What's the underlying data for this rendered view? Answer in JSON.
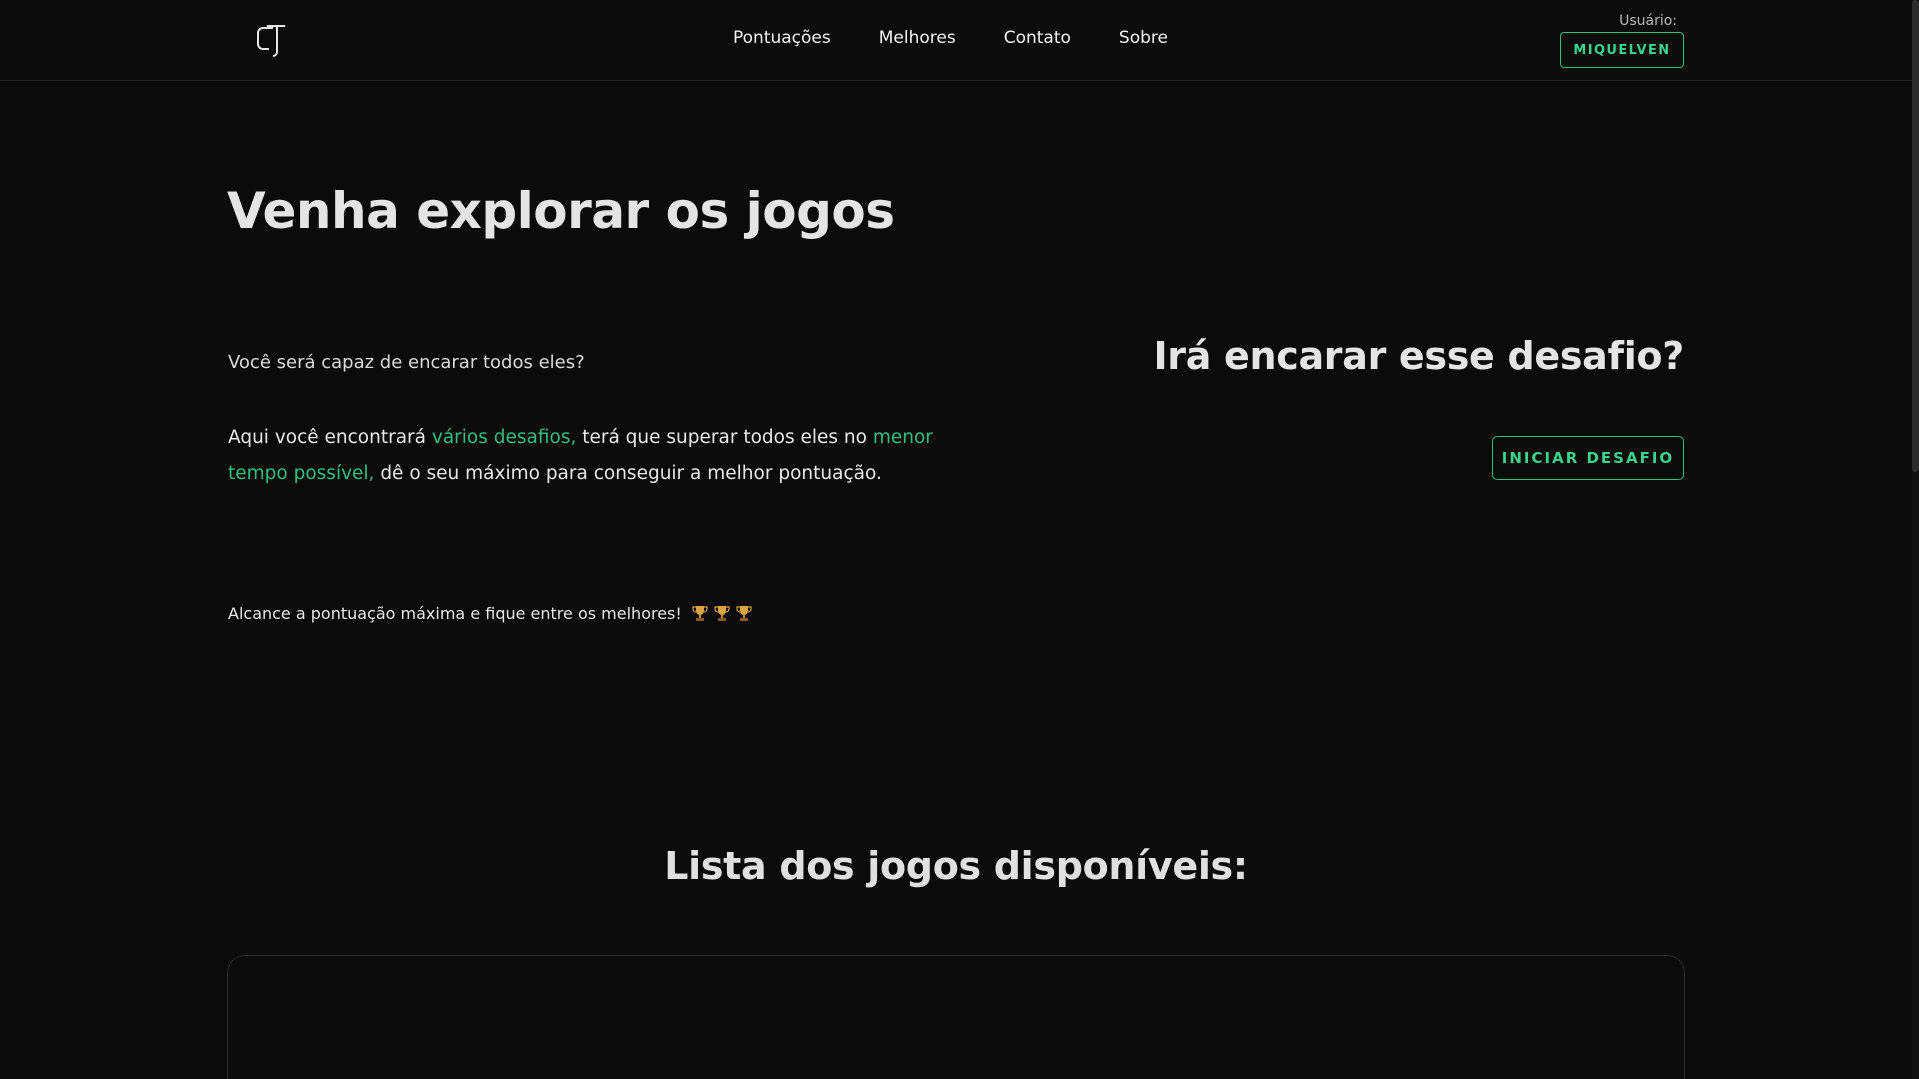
{
  "header": {
    "logo_icon": "gt-logo-icon",
    "nav": [
      {
        "label": "Pontuações"
      },
      {
        "label": "Melhores"
      },
      {
        "label": "Contato"
      },
      {
        "label": "Sobre"
      }
    ],
    "user_label": "Usuário:",
    "user_name": "MIQUELVEN"
  },
  "hero": {
    "title": "Venha explorar os jogos",
    "question": "Você será capaz de encarar todos eles?",
    "desc_part1": "Aqui você encontrará ",
    "desc_accent1": "vários desafios,",
    "desc_part2": " terá que superar todos eles no ",
    "desc_accent2": "menor tempo possível,",
    "desc_part3": " dê o seu máximo para conseguir a melhor pontuação.",
    "right_title": "Irá encarar esse desafio?",
    "start_button": "INICIAR DESAFIO",
    "reach_text": "Alcance a pontuação máxima e fique entre os melhores!",
    "trophy_icons": [
      "trophy-icon",
      "trophy-icon",
      "trophy-icon"
    ]
  },
  "games": {
    "title": "Lista dos jogos disponíveis:"
  },
  "colors": {
    "accent": "#2fbf83",
    "background": "#0b0b0b",
    "text": "#e6e6e6"
  }
}
